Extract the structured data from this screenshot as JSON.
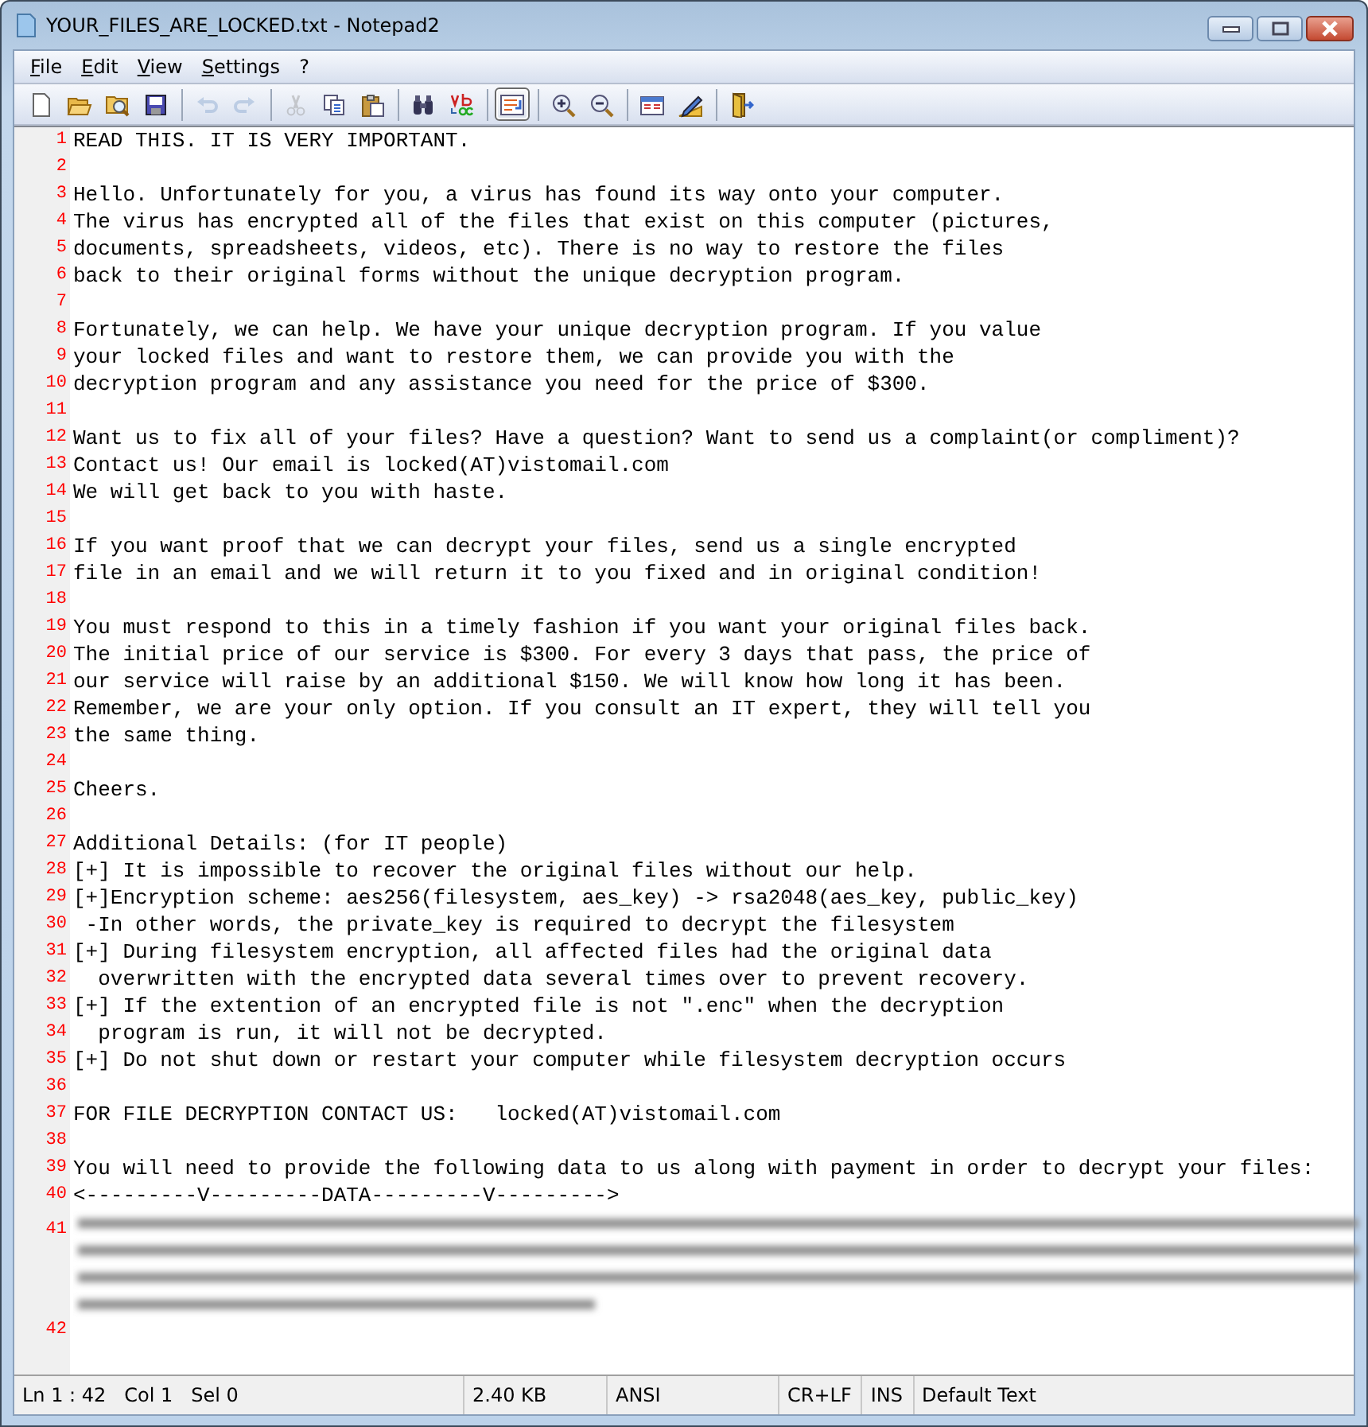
{
  "window": {
    "title": "YOUR_FILES_ARE_LOCKED.txt - Notepad2"
  },
  "menu": [
    "File",
    "Edit",
    "View",
    "Settings",
    "?"
  ],
  "toolbar": [
    {
      "kind": "new",
      "disabled": false,
      "pressed": false
    },
    {
      "kind": "open",
      "disabled": false,
      "pressed": false
    },
    {
      "kind": "browse",
      "disabled": false,
      "pressed": false
    },
    {
      "kind": "save",
      "disabled": false,
      "pressed": false
    },
    {
      "kind": "separator"
    },
    {
      "kind": "undo",
      "disabled": true,
      "pressed": false
    },
    {
      "kind": "redo",
      "disabled": true,
      "pressed": false
    },
    {
      "kind": "separator"
    },
    {
      "kind": "cut",
      "disabled": true,
      "pressed": false
    },
    {
      "kind": "copy",
      "disabled": false,
      "pressed": false
    },
    {
      "kind": "paste",
      "disabled": false,
      "pressed": false
    },
    {
      "kind": "separator"
    },
    {
      "kind": "find",
      "disabled": false,
      "pressed": false
    },
    {
      "kind": "replace",
      "disabled": false,
      "pressed": false
    },
    {
      "kind": "separator"
    },
    {
      "kind": "wordwrap",
      "disabled": false,
      "pressed": true
    },
    {
      "kind": "separator"
    },
    {
      "kind": "zoomin",
      "disabled": false,
      "pressed": false
    },
    {
      "kind": "zoomout",
      "disabled": false,
      "pressed": false
    },
    {
      "kind": "separator"
    },
    {
      "kind": "scheme",
      "disabled": false,
      "pressed": false
    },
    {
      "kind": "customize",
      "disabled": false,
      "pressed": false
    },
    {
      "kind": "separator"
    },
    {
      "kind": "exit",
      "disabled": false,
      "pressed": false
    }
  ],
  "editor": {
    "lines": [
      {
        "number": "1",
        "text": "READ THIS. IT IS VERY IMPORTANT."
      },
      {
        "number": "2"
      },
      {
        "number": "3",
        "text": "Hello. Unfortunately for you, a virus has found its way onto your computer."
      },
      {
        "number": "4",
        "text": "The virus has encrypted all of the files that exist on this computer (pictures,"
      },
      {
        "number": "5",
        "text": "documents, spreadsheets, videos, etc). There is no way to restore the files"
      },
      {
        "number": "6",
        "text": "back to their original forms without the unique decryption program."
      },
      {
        "number": "7"
      },
      {
        "number": "8",
        "text": "Fortunately, we can help. We have your unique decryption program. If you value"
      },
      {
        "number": "9",
        "text": "your locked files and want to restore them, we can provide you with the"
      },
      {
        "number": "10",
        "text": "decryption program and any assistance you need for the price of $300."
      },
      {
        "number": "11"
      },
      {
        "number": "12",
        "text": "Want us to fix all of your files? Have a question? Want to send us a complaint(or compliment)?"
      },
      {
        "number": "13",
        "text": "Contact us! Our email is locked(AT)vistomail.com"
      },
      {
        "number": "14",
        "text": "We will get back to you with haste."
      },
      {
        "number": "15"
      },
      {
        "number": "16",
        "text": "If you want proof that we can decrypt your files, send us a single encrypted"
      },
      {
        "number": "17",
        "text": "file in an email and we will return it to you fixed and in original condition!"
      },
      {
        "number": "18"
      },
      {
        "number": "19",
        "text": "You must respond to this in a timely fashion if you want your original files back."
      },
      {
        "number": "20",
        "text": "The initial price of our service is $300. For every 3 days that pass, the price of"
      },
      {
        "number": "21",
        "text": "our service will raise by an additional $150. We will know how long it has been."
      },
      {
        "number": "22",
        "text": "Remember, we are your only option. If you consult an IT expert, they will tell you"
      },
      {
        "number": "23",
        "text": "the same thing."
      },
      {
        "number": "24"
      },
      {
        "number": "25",
        "text": "Cheers."
      },
      {
        "number": "26"
      },
      {
        "number": "27",
        "text": "Additional Details: (for IT people)"
      },
      {
        "number": "28",
        "text": "[+] It is impossible to recover the original files without our help."
      },
      {
        "number": "29",
        "text": "[+]Encryption scheme: aes256(filesystem, aes_key) -> rsa2048(aes_key, public_key)"
      },
      {
        "number": "30",
        "text": " -In other words, the private_key is required to decrypt the filesystem"
      },
      {
        "number": "31",
        "text": "[+] During filesystem encryption, all affected files had the original data"
      },
      {
        "number": "32",
        "text": "  overwritten with the encrypted data several times over to prevent recovery."
      },
      {
        "number": "33",
        "text": "[+] If the extention of an encrypted file is not \".enc\" when the decryption"
      },
      {
        "number": "34",
        "text": "  program is run, it will not be decrypted."
      },
      {
        "number": "35",
        "text": "[+] Do not shut down or restart your computer while filesystem decryption occurs"
      },
      {
        "number": "36"
      },
      {
        "number": "37",
        "text": "FOR FILE DECRYPTION CONTACT US:   locked(AT)vistomail.com"
      },
      {
        "number": "38"
      },
      {
        "number": "39",
        "text": "You will need to provide the following data to us along with payment in order to decrypt your files:"
      },
      {
        "number": "40",
        "text": "<---------V---------DATA---------V--------->"
      },
      {
        "number": "41",
        "kind": "blurred"
      },
      {
        "number": "42"
      }
    ]
  },
  "status_bar": [
    "Ln 1 : 42   Col 1   Sel 0",
    "2.40 KB",
    "ANSI",
    "CR+LF",
    "INS",
    "Default Text"
  ]
}
